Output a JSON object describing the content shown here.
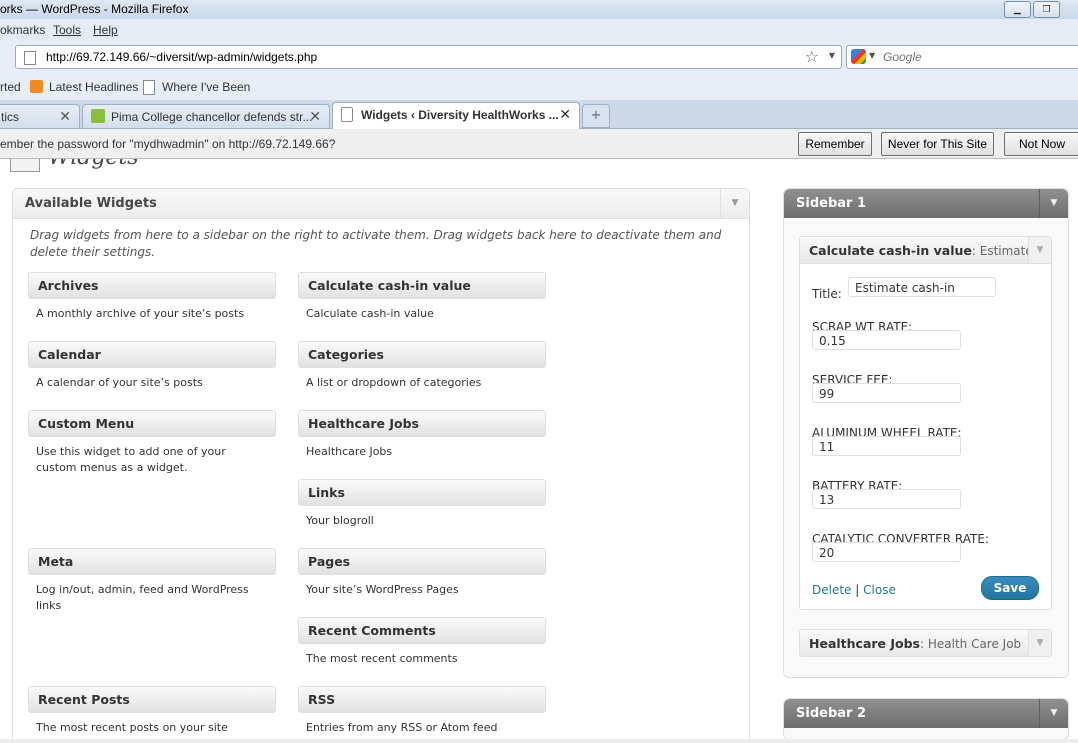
{
  "window": {
    "title": "orks — WordPress - Mozilla Firefox"
  },
  "menu": {
    "bookmarks": "okmarks",
    "tools": "Tools",
    "help": "Help"
  },
  "nav": {
    "url": "http://69.72.149.66/~diversit/wp-admin/widgets.php",
    "search_placeholder": "Google"
  },
  "bookmarks": {
    "started": "rted",
    "latest": "Latest Headlines",
    "where": "Where I've Been"
  },
  "tabs": [
    {
      "label": "tics"
    },
    {
      "label": "Pima College chancellor defends str..."
    },
    {
      "label": "Widgets ‹ Diversity HealthWorks ..."
    }
  ],
  "notification": {
    "message": "ember the password for \"mydhwadmin\" on http://69.72.149.66?",
    "remember": "Remember",
    "never": "Never for This Site",
    "not_now": "Not Now"
  },
  "page": {
    "title": "Widgets"
  },
  "available": {
    "title": "Available Widgets",
    "description": "Drag widgets from here to a sidebar on the right to activate them. Drag widgets back here to deactivate them and delete their settings.",
    "widgets": [
      {
        "title": "Archives",
        "desc": "A monthly archive of your site’s posts"
      },
      {
        "title": "Calculate cash-in value",
        "desc": "Calculate cash-in value"
      },
      {
        "title": "Calendar",
        "desc": "A calendar of your site’s posts"
      },
      {
        "title": "Categories",
        "desc": "A list or dropdown of categories"
      },
      {
        "title": "Custom Menu",
        "desc": "Use this widget to add one of your custom menus as a widget."
      },
      {
        "title": "Healthcare Jobs",
        "desc": "Healthcare Jobs"
      },
      {
        "title": "Links",
        "desc": "Your blogroll"
      },
      {
        "title": "Meta",
        "desc": "Log in/out, admin, feed and WordPress links"
      },
      {
        "title": "Pages",
        "desc": "Your site’s WordPress Pages"
      },
      {
        "title": "Recent Comments",
        "desc": "The most recent comments"
      },
      {
        "title": "Recent Posts",
        "desc": "The most recent posts on your site"
      },
      {
        "title": "RSS",
        "desc": "Entries from any RSS or Atom feed"
      }
    ]
  },
  "sidebar1": {
    "title": "Sidebar 1",
    "calc_widget": {
      "name": "Calculate cash-in value",
      "instance_title": ": Estimate",
      "title_label": "Title:",
      "title_value": "Estimate cash-in",
      "fields": [
        {
          "label": "SCRAP WT RATE:",
          "value": "0.15"
        },
        {
          "label": "SERVICE FEE:",
          "value": "99"
        },
        {
          "label": "ALUMINUM WHEEL RATE:",
          "value": "11"
        },
        {
          "label": "BATTERY RATE:",
          "value": "13"
        },
        {
          "label": "CATALYTIC CONVERTER RATE:",
          "value": "20"
        }
      ],
      "delete": "Delete",
      "sep": "|",
      "close": "Close",
      "save": "Save"
    },
    "jobs_widget": {
      "name": "Healthcare Jobs",
      "instance_title": ": Health Care Job"
    }
  },
  "sidebar2": {
    "title": "Sidebar 2"
  }
}
